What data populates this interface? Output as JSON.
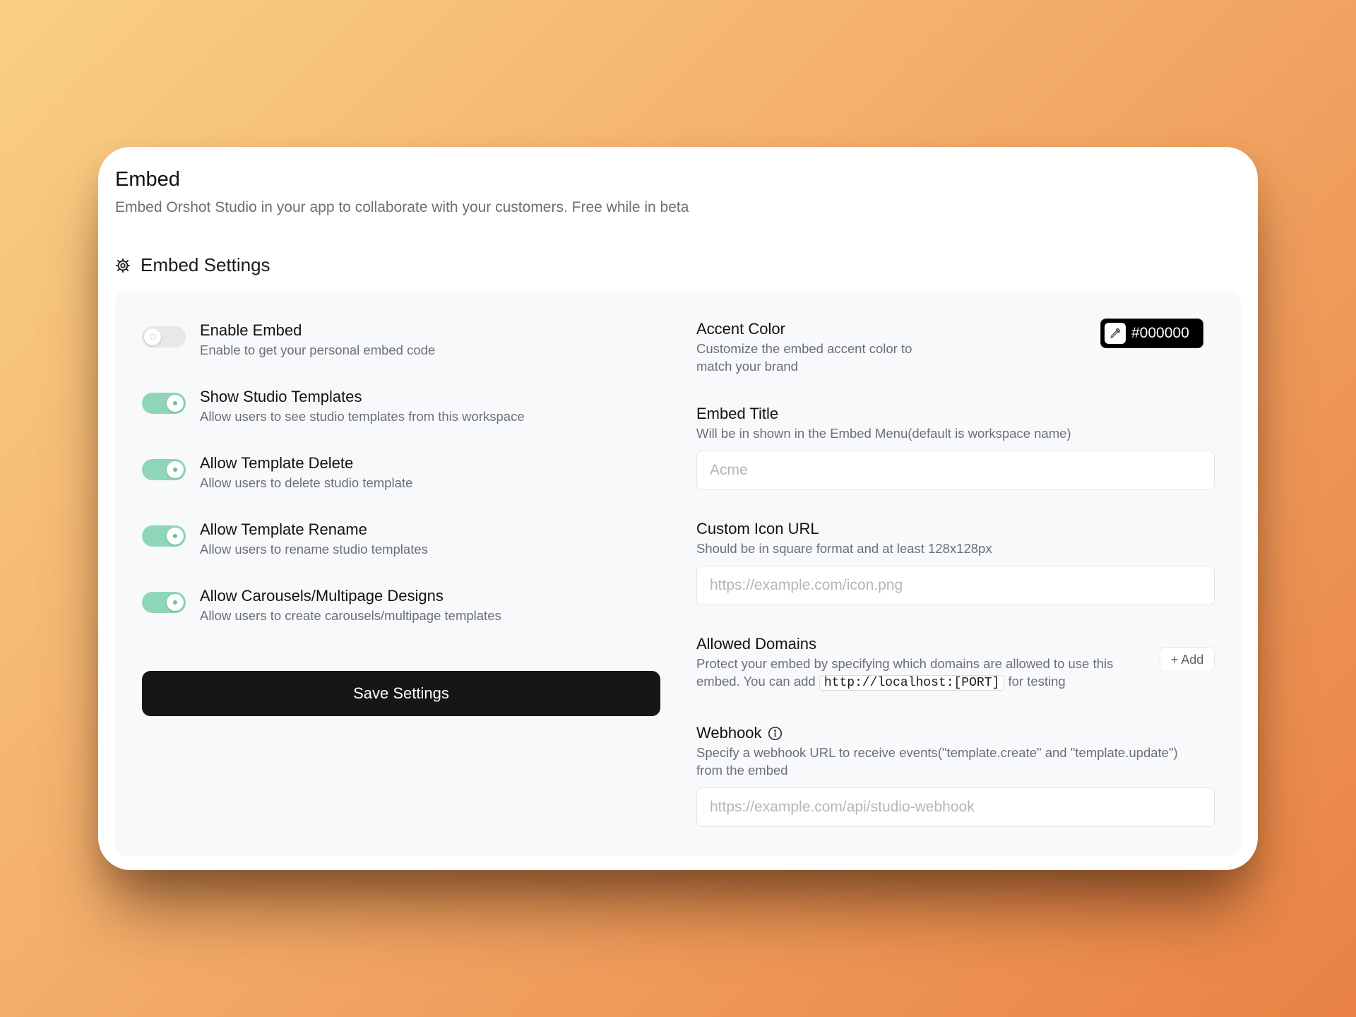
{
  "header": {
    "title": "Embed",
    "subtitle": "Embed Orshot Studio in your app to collaborate with your customers. Free while in beta"
  },
  "section": {
    "title": "Embed Settings",
    "icon": "gear-icon"
  },
  "toggles": [
    {
      "label": "Enable Embed",
      "description": "Enable to get your personal embed code",
      "on": false
    },
    {
      "label": "Show Studio Templates",
      "description": "Allow users to see studio templates from this workspace",
      "on": true
    },
    {
      "label": "Allow Template Delete",
      "description": "Allow users to delete studio template",
      "on": true
    },
    {
      "label": "Allow Template Rename",
      "description": "Allow users to rename studio templates",
      "on": true
    },
    {
      "label": "Allow Carousels/Multipage Designs",
      "description": "Allow users to create carousels/multipage templates",
      "on": true
    }
  ],
  "save_label": "Save Settings",
  "accent_color": {
    "label": "Accent Color",
    "description_line1": "Customize the embed accent color to",
    "description_line2": "match your brand",
    "value": "#000000",
    "icon": "eyedropper-icon"
  },
  "embed_title": {
    "label": "Embed Title",
    "description": "Will be in shown in the Embed Menu(default is workspace name)",
    "placeholder": "Acme"
  },
  "custom_icon": {
    "label": "Custom Icon URL",
    "description": "Should be in square format and at least 128x128px",
    "placeholder": "https://example.com/icon.png"
  },
  "allowed_domains": {
    "label": "Allowed Domains",
    "description_line1": "Protect your embed by specifying which domains are allowed to use this",
    "description_prefix": "embed. You can add",
    "code": "http://localhost:[PORT]",
    "description_suffix": "for testing",
    "add_label": "+ Add"
  },
  "webhook": {
    "label": "Webhook",
    "icon": "info-icon",
    "description_line1": "Specify a webhook URL to receive events(\"template.create\" and \"template.update\")",
    "description_line2": "from the embed",
    "placeholder": "https://example.com/api/studio-webhook"
  },
  "colors": {
    "toggle_on": "#8fd6b8",
    "toggle_off": "#e7e8ea",
    "button": "#161616"
  }
}
